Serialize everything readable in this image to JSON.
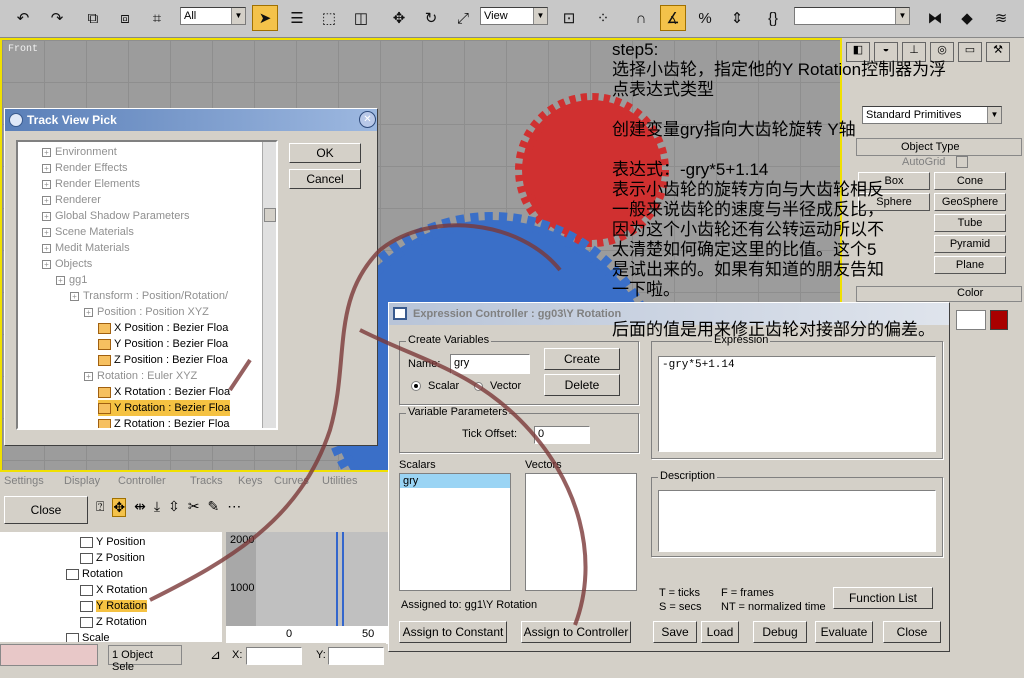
{
  "toolbar": {
    "filter_value": "All",
    "coord_value": "View",
    "chinese_text": ""
  },
  "viewport": {
    "label": "Front"
  },
  "note": {
    "lines": [
      "step5:",
      "选择小齿轮，指定他的Y  Rotation控制器为浮点表达式类型",
      "",
      "创建变量gry指向大齿轮旋转 Y轴",
      "",
      "表达式：-gry*5+1.14",
      "表示小齿轮的旋转方向与大齿轮相反",
      "一般来说齿轮的速度与半径成反比，",
      "因为这个小齿轮还有公转运动所以不",
      "太清楚如何确定这里的比值。这个5",
      "是试出来的。如果有知道的朋友告知",
      "一下啦。",
      "",
      "后面的值是用来修正齿轮对接部分的偏差。"
    ]
  },
  "right_panel": {
    "primitives": "Standard Primitives",
    "object_type": "Object Type",
    "autogrid": "AutoGrid",
    "buttons": [
      "Box",
      "Cone",
      "Sphere",
      "GeoSphere",
      "",
      "Tube",
      "",
      "Pyramid",
      "",
      "Plane"
    ],
    "color_label": "Color",
    "swatch": "#a80000"
  },
  "track_view": {
    "title": "Track View Pick",
    "ok": "OK",
    "cancel": "Cancel",
    "rows": [
      {
        "t": "Environment",
        "g": true
      },
      {
        "t": "Render Effects",
        "g": true
      },
      {
        "t": "Render Elements",
        "g": true
      },
      {
        "t": "Renderer",
        "g": true
      },
      {
        "t": "Global Shadow Parameters",
        "g": true
      },
      {
        "t": "Scene Materials",
        "g": true
      },
      {
        "t": "Medit Materials",
        "g": true
      },
      {
        "t": "Objects",
        "g": true
      },
      {
        "t": "gg1",
        "g": true
      },
      {
        "t": "Transform : Position/Rotation/",
        "g": true
      },
      {
        "t": "Position : Position XYZ",
        "g": true
      },
      {
        "t": "X Position : Bezier Floa",
        "g": false
      },
      {
        "t": "Y Position : Bezier Floa",
        "g": false
      },
      {
        "t": "Z Position : Bezier Floa",
        "g": false
      },
      {
        "t": "Rotation : Euler XYZ",
        "g": true
      },
      {
        "t": "X Rotation : Bezier Floa",
        "g": false
      },
      {
        "t": "Y Rotation : Bezier Floa",
        "g": false
      },
      {
        "t": "Z Rotation : Bezier Floa",
        "g": false
      }
    ]
  },
  "expr_ctrl": {
    "title": "Expression Controller : gg03\\Y Rotation",
    "create_vars": "Create Variables",
    "name_label": "Name:",
    "name_value": "gry",
    "create": "Create",
    "delete": "Delete",
    "scalar": "Scalar",
    "vector": "Vector",
    "var_params": "Variable Parameters",
    "tick_offset": "Tick Offset:",
    "tick_value": "0",
    "scalars": "Scalars",
    "vectors": "Vectors",
    "scalar_item": "gry",
    "assigned_to": "Assigned to:  gg1\\Y Rotation",
    "assign_constant": "Assign to Constant",
    "assign_controller": "Assign to Controller",
    "expression_label": "Expression",
    "expression": "-gry*5+1.14",
    "description": "Description",
    "legend": [
      "T = ticks",
      "F = frames",
      "S = secs",
      "NT = normalized time"
    ],
    "function_list": "Function List",
    "save": "Save",
    "load": "Load",
    "debug": "Debug",
    "evaluate": "Evaluate",
    "close": "Close"
  },
  "curve_editor": {
    "tabs": [
      "Settings",
      "Display",
      "Controller",
      "Tracks",
      "Keys",
      "Curves",
      "Utilities"
    ],
    "close": "Close",
    "tree": [
      "Y Position",
      "Z Position",
      "Rotation",
      "X Rotation",
      "Y Rotation",
      "Z Rotation",
      "Scale"
    ],
    "y_ticks": [
      "2000",
      "1000"
    ],
    "x_ticks": [
      "0",
      "50"
    ]
  },
  "status": {
    "selected": "1 Object Sele",
    "x_label": "X:",
    "y_label": "Y:"
  }
}
